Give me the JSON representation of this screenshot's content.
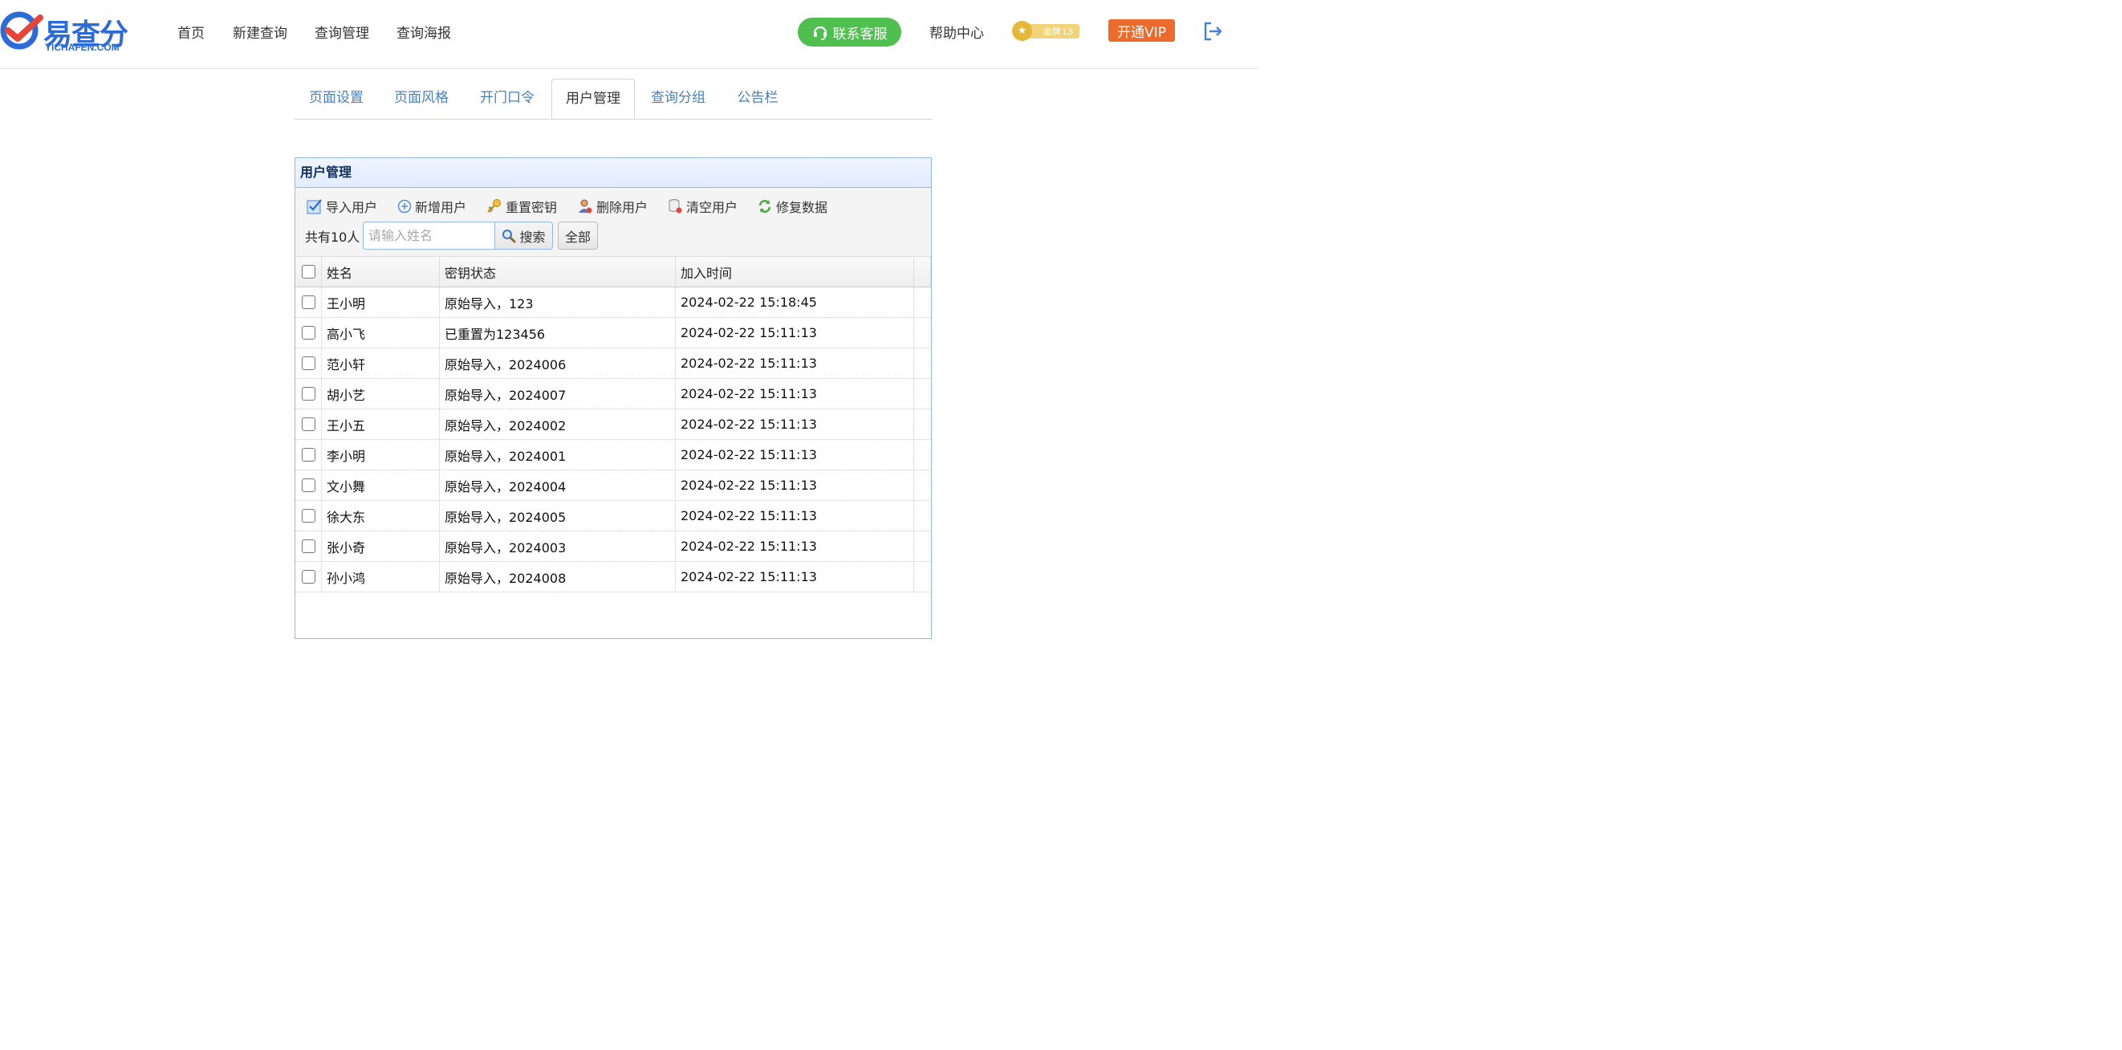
{
  "brand": {
    "name": "易查分",
    "domain": "YICHAFEN.COM",
    "color": "#2d6bd8"
  },
  "nav": {
    "items": [
      "首页",
      "新建查询",
      "查询管理",
      "查询海报"
    ],
    "support_label": "联系客服",
    "help_label": "帮助中心",
    "badge_label": "金牌 L3",
    "vip_label": "开通VIP",
    "logout_icon": "logout-icon"
  },
  "tabs": {
    "items": [
      "页面设置",
      "页面风格",
      "开门口令",
      "用户管理",
      "查询分组",
      "公告栏"
    ],
    "active_index": 3
  },
  "panel": {
    "title": "用户管理",
    "toolbar": {
      "import": "导入用户",
      "add": "新增用户",
      "reset": "重置密钥",
      "delete": "删除用户",
      "clear": "清空用户",
      "repair": "修复数据"
    },
    "count_text": "共有10人",
    "search_placeholder": "请输入姓名",
    "search_label": "搜索",
    "all_label": "全部"
  },
  "table": {
    "columns": [
      "姓名",
      "密钥状态",
      "加入时间"
    ],
    "rows": [
      {
        "name": "王小明",
        "key_status": "原始导入，123",
        "joined": "2024-02-22 15:18:45"
      },
      {
        "name": "高小飞",
        "key_status": "已重置为123456",
        "joined": "2024-02-22 15:11:13"
      },
      {
        "name": "范小轩",
        "key_status": "原始导入，2024006",
        "joined": "2024-02-22 15:11:13"
      },
      {
        "name": "胡小艺",
        "key_status": "原始导入，2024007",
        "joined": "2024-02-22 15:11:13"
      },
      {
        "name": "王小五",
        "key_status": "原始导入，2024002",
        "joined": "2024-02-22 15:11:13"
      },
      {
        "name": "李小明",
        "key_status": "原始导入，2024001",
        "joined": "2024-02-22 15:11:13"
      },
      {
        "name": "文小舞",
        "key_status": "原始导入，2024004",
        "joined": "2024-02-22 15:11:13"
      },
      {
        "name": "徐大东",
        "key_status": "原始导入，2024005",
        "joined": "2024-02-22 15:11:13"
      },
      {
        "name": "张小奇",
        "key_status": "原始导入，2024003",
        "joined": "2024-02-22 15:11:13"
      },
      {
        "name": "孙小鸿",
        "key_status": "原始导入，2024008",
        "joined": "2024-02-22 15:11:13"
      }
    ]
  },
  "colors": {
    "support_green": "#4fbf4f",
    "vip_orange": "#ec6a2c",
    "tab_link": "#4a7fc0",
    "panel_border": "#95b8e7"
  }
}
